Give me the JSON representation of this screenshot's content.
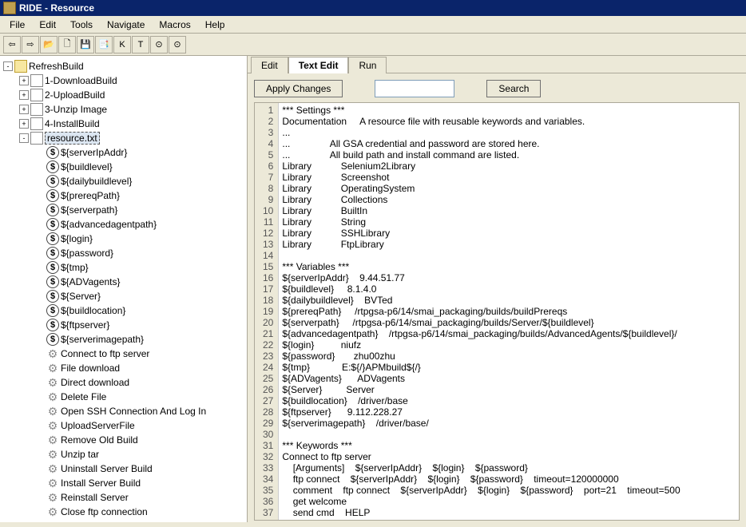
{
  "title": "RIDE - Resource",
  "menu": [
    "File",
    "Edit",
    "Tools",
    "Navigate",
    "Macros",
    "Help"
  ],
  "toolbar_buttons": [
    "⇦",
    "⇨",
    "📂",
    "🗋",
    "💾",
    "📑",
    "K",
    "T",
    "⊙",
    "⊙"
  ],
  "tree": {
    "root": {
      "label": "RefreshBuild",
      "expander": "-",
      "icon": "folder"
    },
    "children": [
      {
        "label": "1-DownloadBuild",
        "expander": "+",
        "icon": "file",
        "indent": 1
      },
      {
        "label": "2-UploadBuild",
        "expander": "+",
        "icon": "file",
        "indent": 1
      },
      {
        "label": "3-Unzip Image",
        "expander": "+",
        "icon": "file",
        "indent": 1
      },
      {
        "label": "4-InstallBuild",
        "expander": "+",
        "icon": "file",
        "indent": 1
      },
      {
        "label": "resource.txt",
        "expander": "-",
        "icon": "file",
        "indent": 1,
        "selected": true
      },
      {
        "label": "${serverIpAddr}",
        "expander": "",
        "icon": "dollar",
        "indent": 2
      },
      {
        "label": "${buildlevel}",
        "expander": "",
        "icon": "dollar",
        "indent": 2
      },
      {
        "label": "${dailybuildlevel}",
        "expander": "",
        "icon": "dollar",
        "indent": 2
      },
      {
        "label": "${prereqPath}",
        "expander": "",
        "icon": "dollar",
        "indent": 2
      },
      {
        "label": "${serverpath}",
        "expander": "",
        "icon": "dollar",
        "indent": 2
      },
      {
        "label": "${advancedagentpath}",
        "expander": "",
        "icon": "dollar",
        "indent": 2
      },
      {
        "label": "${login}",
        "expander": "",
        "icon": "dollar",
        "indent": 2
      },
      {
        "label": "${password}",
        "expander": "",
        "icon": "dollar",
        "indent": 2
      },
      {
        "label": "${tmp}",
        "expander": "",
        "icon": "dollar",
        "indent": 2
      },
      {
        "label": "${ADVagents}",
        "expander": "",
        "icon": "dollar",
        "indent": 2
      },
      {
        "label": "${Server}",
        "expander": "",
        "icon": "dollar",
        "indent": 2
      },
      {
        "label": "${buildlocation}",
        "expander": "",
        "icon": "dollar",
        "indent": 2
      },
      {
        "label": "${ftpserver}",
        "expander": "",
        "icon": "dollar",
        "indent": 2
      },
      {
        "label": "${serverimagepath}",
        "expander": "",
        "icon": "dollar",
        "indent": 2
      },
      {
        "label": "Connect to ftp server",
        "expander": "",
        "icon": "gear",
        "indent": 2
      },
      {
        "label": "File download",
        "expander": "",
        "icon": "gear",
        "indent": 2
      },
      {
        "label": "Direct download",
        "expander": "",
        "icon": "gear",
        "indent": 2
      },
      {
        "label": "Delete File",
        "expander": "",
        "icon": "gear",
        "indent": 2
      },
      {
        "label": "Open SSH Connection And Log In",
        "expander": "",
        "icon": "gear",
        "indent": 2
      },
      {
        "label": "UploadServerFile",
        "expander": "",
        "icon": "gear",
        "indent": 2
      },
      {
        "label": "Remove Old Build",
        "expander": "",
        "icon": "gear",
        "indent": 2
      },
      {
        "label": "Unzip tar",
        "expander": "",
        "icon": "gear",
        "indent": 2
      },
      {
        "label": "Uninstall Server Build",
        "expander": "",
        "icon": "gear",
        "indent": 2
      },
      {
        "label": "Install Server Build",
        "expander": "",
        "icon": "gear",
        "indent": 2
      },
      {
        "label": "Reinstall Server",
        "expander": "",
        "icon": "gear",
        "indent": 2
      },
      {
        "label": "Close ftp connection",
        "expander": "",
        "icon": "gear",
        "indent": 2
      }
    ]
  },
  "tabs": [
    {
      "label": "Edit",
      "active": false
    },
    {
      "label": "Text Edit",
      "active": true
    },
    {
      "label": "Run",
      "active": false
    }
  ],
  "buttons": {
    "apply": "Apply Changes",
    "search": "Search"
  },
  "editor_lines": [
    "*** Settings ***",
    "Documentation     A resource file with reusable keywords and variables.",
    "...",
    "...               All GSA credential and password are stored here.",
    "...               All build path and install command are listed.",
    "Library           Selenium2Library",
    "Library           Screenshot",
    "Library           OperatingSystem",
    "Library           Collections",
    "Library           BuiltIn",
    "Library           String",
    "Library           SSHLibrary",
    "Library           FtpLibrary",
    "",
    "*** Variables ***",
    "${serverIpAddr}    9.44.51.77",
    "${buildlevel}     8.1.4.0",
    "${dailybuildlevel}    BVTed",
    "${prereqPath}     /rtpgsa-p6/14/smai_packaging/builds/buildPrereqs",
    "${serverpath}     /rtpgsa-p6/14/smai_packaging/builds/Server/${buildlevel}",
    "${advancedagentpath}    /rtpgsa-p6/14/smai_packaging/builds/AdvancedAgents/${buildlevel}/",
    "${login}          niufz",
    "${password}       zhu00zhu",
    "${tmp}            E:${/}APMbuild${/}",
    "${ADVagents}      ADVagents",
    "${Server}         Server",
    "${buildlocation}    /driver/base",
    "${ftpserver}      9.112.228.27",
    "${serverimagepath}    /driver/base/",
    "",
    "*** Keywords ***",
    "Connect to ftp server",
    "    [Arguments]    ${serverIpAddr}    ${login}    ${password}",
    "    ftp connect    ${serverIpAddr}    ${login}    ${password}    timeout=120000000",
    "    comment    ftp connect    ${serverIpAddr}    ${login}    ${password}    port=21    timeout=500",
    "    get welcome",
    "    send cmd    HELP"
  ]
}
